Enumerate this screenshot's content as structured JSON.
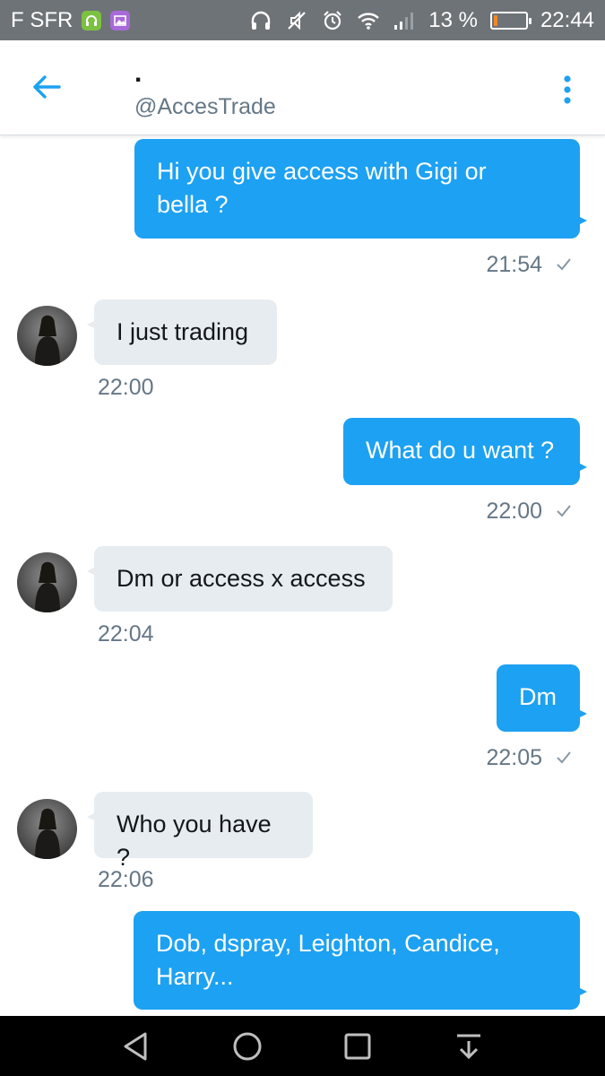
{
  "status_bar": {
    "carrier": "F SFR",
    "battery_percent": "13 %",
    "battery_level": 0.13,
    "time": "22:44",
    "icons": [
      "headset-icon",
      "gallery-icon",
      "headphones-icon",
      "mute-icon",
      "alarm-icon",
      "wifi-icon",
      "signal-icon",
      "battery-icon"
    ]
  },
  "header": {
    "title": ".",
    "handle": "@AccesTrade"
  },
  "colors": {
    "accent": "#1da1f2",
    "incoming_bubble": "#e6ecf0",
    "status_bar": "#6e7378",
    "battery": "#f08a24"
  },
  "messages": [
    {
      "direction": "out",
      "lines": [
        "Hi you give access with Gigi or",
        "bella ?"
      ],
      "time": "21:54"
    },
    {
      "direction": "in",
      "text": "I just trading",
      "time": "22:00"
    },
    {
      "direction": "out",
      "text": "What do u want ?",
      "time": "22:00"
    },
    {
      "direction": "in",
      "text": "Dm or access x access",
      "time": "22:04"
    },
    {
      "direction": "out",
      "text": "Dm",
      "time": "22:05"
    },
    {
      "direction": "in",
      "text": "Who you have ?",
      "time": "22:06"
    },
    {
      "direction": "out",
      "lines": [
        "Dob, dspray, Leighton, Candice,",
        "Harry..."
      ]
    }
  ]
}
